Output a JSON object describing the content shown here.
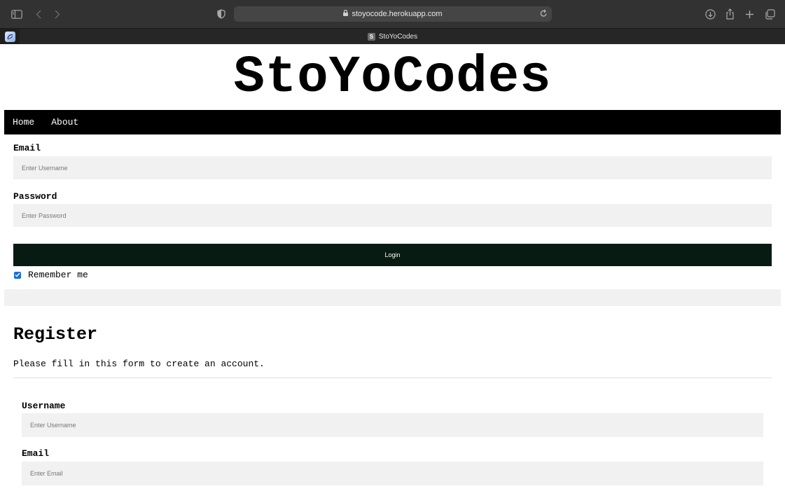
{
  "browser": {
    "url": "stoyocode.herokuapp.com",
    "tab_title": "StoYoCodes",
    "tab_favicon_letter": "S"
  },
  "site": {
    "title": "StoYoCodes",
    "nav": [
      "Home",
      "About"
    ]
  },
  "login": {
    "email_label": "Email",
    "email_placeholder": "Enter Username",
    "password_label": "Password",
    "password_placeholder": "Enter Password",
    "login_button": "Login",
    "remember_label": "Remember me",
    "remember_checked": true
  },
  "register": {
    "title": "Register",
    "subtitle": "Please fill in this form to create an account.",
    "username_label": "Username",
    "username_placeholder": "Enter Username",
    "email_label": "Email",
    "email_placeholder": "Enter Email"
  },
  "colors": {
    "navbar": "#000000",
    "login_button": "#071b12",
    "input_bg": "#f1f1f1",
    "checkbox": "#1a6fe0"
  }
}
